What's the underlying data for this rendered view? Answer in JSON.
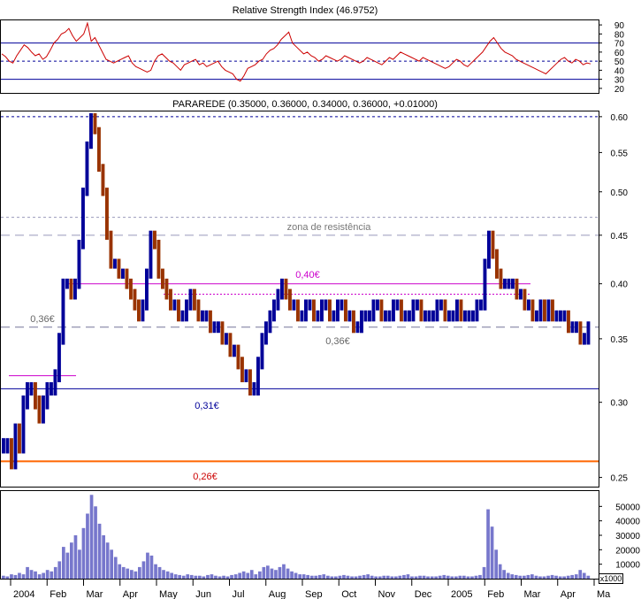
{
  "colors": {
    "frame": "#000000",
    "rsi_line": "#cc0000",
    "rsi_levels": "#000099",
    "bar_up": "#000099",
    "bar_down": "#993300",
    "volume_fill": "#7777cc",
    "volume_stroke": "#5555aa",
    "resistance": "#9999bb",
    "support_036": "#777799",
    "line_040": "#cc00cc",
    "line_031": "#000099",
    "line_026": "#ff6600",
    "label_026": "#cc0000",
    "label_gray": "#666666"
  },
  "chart_data": [
    {
      "panel": "rsi",
      "type": "line",
      "title": "Relative Strength Index (46.9752)",
      "ylim": [
        15,
        95
      ],
      "yticks": [
        "90",
        "80",
        "70",
        "60",
        "50",
        "40",
        "30",
        "20"
      ],
      "ytick_values": [
        90,
        80,
        70,
        60,
        50,
        40,
        30,
        20
      ],
      "levels": [
        70,
        50,
        30
      ],
      "series": [
        {
          "values": [
            58,
            55,
            50,
            48,
            56,
            62,
            68,
            65,
            60,
            56,
            58,
            52,
            55,
            62,
            70,
            74,
            80,
            82,
            86,
            78,
            72,
            76,
            80,
            92,
            72,
            76,
            68,
            60,
            52,
            50,
            48,
            50,
            52,
            54,
            56,
            48,
            44,
            42,
            40,
            38,
            40,
            50,
            56,
            58,
            54,
            50,
            48,
            44,
            40,
            46,
            48,
            50,
            52,
            46,
            48,
            44,
            46,
            48,
            50,
            44,
            40,
            38,
            36,
            30,
            28,
            34,
            42,
            44,
            46,
            50,
            52,
            58,
            62,
            64,
            68,
            74,
            78,
            82,
            70,
            66,
            62,
            58,
            60,
            56,
            54,
            50,
            52,
            56,
            54,
            52,
            50,
            52,
            56,
            54,
            52,
            50,
            48,
            50,
            54,
            52,
            50,
            48,
            46,
            50,
            54,
            52,
            56,
            60,
            58,
            56,
            54,
            52,
            50,
            54,
            52,
            50,
            48,
            46,
            44,
            42,
            44,
            48,
            52,
            50,
            46,
            44,
            48,
            52,
            56,
            60,
            66,
            72,
            76,
            70,
            64,
            60,
            58,
            56,
            52,
            50,
            48,
            46,
            44,
            42,
            40,
            38,
            36,
            40,
            44,
            48,
            52,
            54,
            50,
            48,
            52,
            50,
            46,
            48,
            47
          ]
        }
      ]
    },
    {
      "panel": "price",
      "type": "bar",
      "title": "PARAREDE (0.35000, 0.36000, 0.34000, 0.36000, +0.01000)",
      "ylim": [
        0.245,
        0.605
      ],
      "log_scale": true,
      "yticks": [
        "0.60",
        "0.55",
        "0.50",
        "0.45",
        "0.40",
        "0.35",
        "0.30",
        "0.25"
      ],
      "ytick_values": [
        0.6,
        0.55,
        0.5,
        0.45,
        0.4,
        0.35,
        0.3,
        0.25
      ],
      "close": [
        0.27,
        0.27,
        0.26,
        0.28,
        0.27,
        0.3,
        0.31,
        0.31,
        0.3,
        0.29,
        0.3,
        0.31,
        0.31,
        0.32,
        0.35,
        0.4,
        0.4,
        0.39,
        0.4,
        0.44,
        0.5,
        0.56,
        0.6,
        0.58,
        0.53,
        0.5,
        0.45,
        0.42,
        0.42,
        0.41,
        0.41,
        0.4,
        0.39,
        0.38,
        0.37,
        0.38,
        0.41,
        0.45,
        0.44,
        0.41,
        0.4,
        0.39,
        0.38,
        0.38,
        0.37,
        0.37,
        0.38,
        0.39,
        0.38,
        0.37,
        0.37,
        0.37,
        0.36,
        0.36,
        0.36,
        0.35,
        0.35,
        0.34,
        0.34,
        0.33,
        0.32,
        0.32,
        0.31,
        0.31,
        0.33,
        0.35,
        0.36,
        0.37,
        0.38,
        0.39,
        0.4,
        0.39,
        0.38,
        0.38,
        0.37,
        0.37,
        0.38,
        0.38,
        0.37,
        0.37,
        0.38,
        0.38,
        0.37,
        0.37,
        0.38,
        0.38,
        0.37,
        0.37,
        0.36,
        0.36,
        0.37,
        0.37,
        0.37,
        0.38,
        0.38,
        0.37,
        0.37,
        0.37,
        0.38,
        0.38,
        0.37,
        0.37,
        0.37,
        0.38,
        0.38,
        0.37,
        0.37,
        0.37,
        0.37,
        0.38,
        0.38,
        0.37,
        0.37,
        0.37,
        0.38,
        0.37,
        0.37,
        0.37,
        0.37,
        0.38,
        0.38,
        0.42,
        0.45,
        0.43,
        0.41,
        0.4,
        0.4,
        0.4,
        0.4,
        0.39,
        0.39,
        0.38,
        0.38,
        0.37,
        0.37,
        0.38,
        0.37,
        0.38,
        0.37,
        0.37,
        0.37,
        0.37,
        0.36,
        0.36,
        0.36,
        0.35,
        0.35,
        0.36
      ],
      "hlines": [
        {
          "value": 0.6,
          "style": "dotted"
        },
        {
          "value": 0.47,
          "style": "dotted"
        },
        {
          "value": 0.45,
          "style": "dashed",
          "label": "zona de resistência"
        },
        {
          "value": 0.4,
          "style": "solid",
          "label": "0,40€"
        },
        {
          "value": 0.39,
          "style": "dotted"
        },
        {
          "value": 0.36,
          "style": "dashed",
          "label": "0,36€"
        },
        {
          "value": 0.31,
          "style": "solid",
          "label": "0,31€"
        },
        {
          "value": 0.26,
          "style": "solid",
          "label": "0,26€"
        },
        {
          "value": 0.32,
          "style": "solid"
        }
      ],
      "label_036_right": "0,36€"
    },
    {
      "panel": "volume",
      "type": "bar",
      "ylim": [
        0,
        60000
      ],
      "yticks": [
        "50000",
        "40000",
        "30000",
        "20000",
        "10000"
      ],
      "ytick_values": [
        50000,
        40000,
        30000,
        20000,
        10000
      ],
      "unit_label": "x1000",
      "values": [
        2000,
        1500,
        3000,
        2500,
        4000,
        3000,
        8000,
        6000,
        5000,
        3000,
        4000,
        6000,
        5000,
        8000,
        12000,
        22000,
        18000,
        25000,
        30000,
        20000,
        35000,
        45000,
        58000,
        50000,
        38000,
        30000,
        25000,
        20000,
        15000,
        10000,
        8000,
        7000,
        6000,
        5000,
        8000,
        12000,
        18000,
        16000,
        10000,
        8000,
        6000,
        5000,
        4000,
        3000,
        2500,
        2000,
        3000,
        2500,
        2000,
        2000,
        1500,
        2500,
        3000,
        2000,
        1500,
        2000,
        1500,
        2500,
        3000,
        4000,
        5000,
        4000,
        6000,
        3000,
        5000,
        8000,
        9000,
        7000,
        6000,
        8000,
        10000,
        7000,
        5000,
        4000,
        3000,
        3000,
        2500,
        2000,
        2000,
        2500,
        3000,
        2000,
        1500,
        1500,
        2000,
        2500,
        2000,
        1500,
        1500,
        2000,
        2500,
        3000,
        2000,
        1500,
        1500,
        2000,
        2000,
        1500,
        1500,
        2000,
        2500,
        3000,
        1500,
        1500,
        2000,
        2000,
        1500,
        1500,
        1500,
        2000,
        2500,
        2000,
        1500,
        1500,
        2000,
        2000,
        1500,
        1500,
        2000,
        2500,
        8000,
        48000,
        36000,
        20000,
        10000,
        6000,
        4000,
        3000,
        2500,
        2000,
        2000,
        2500,
        3000,
        2000,
        1500,
        1500,
        2000,
        2500,
        2000,
        1500,
        1500,
        2000,
        2500,
        3000,
        6000,
        4000,
        2000
      ]
    }
  ],
  "x_axis": {
    "labels": [
      "2004",
      "Feb",
      "Mar",
      "Apr",
      "May",
      "Jun",
      "Jul",
      "Aug",
      "Sep",
      "Oct",
      "Nov",
      "Dec",
      "2005",
      "Feb",
      "Mar",
      "Apr",
      "Ma"
    ]
  }
}
